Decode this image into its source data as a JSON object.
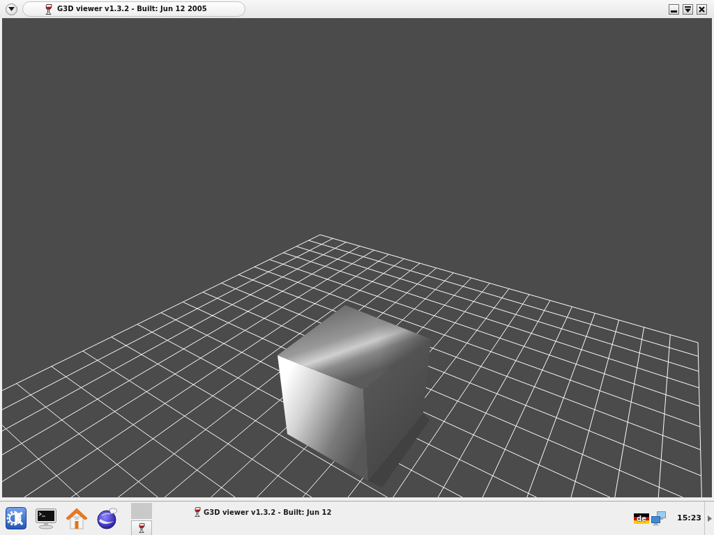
{
  "window": {
    "title": "G3D viewer v1.3.2 - Built: Jun 12 2005"
  },
  "taskbar": {
    "tasks": [
      {
        "title": "G3D viewer v1.3.2 - Built: Jun 12"
      }
    ],
    "tray": {
      "keyboard_layout": "de",
      "clock": "15:23"
    }
  }
}
